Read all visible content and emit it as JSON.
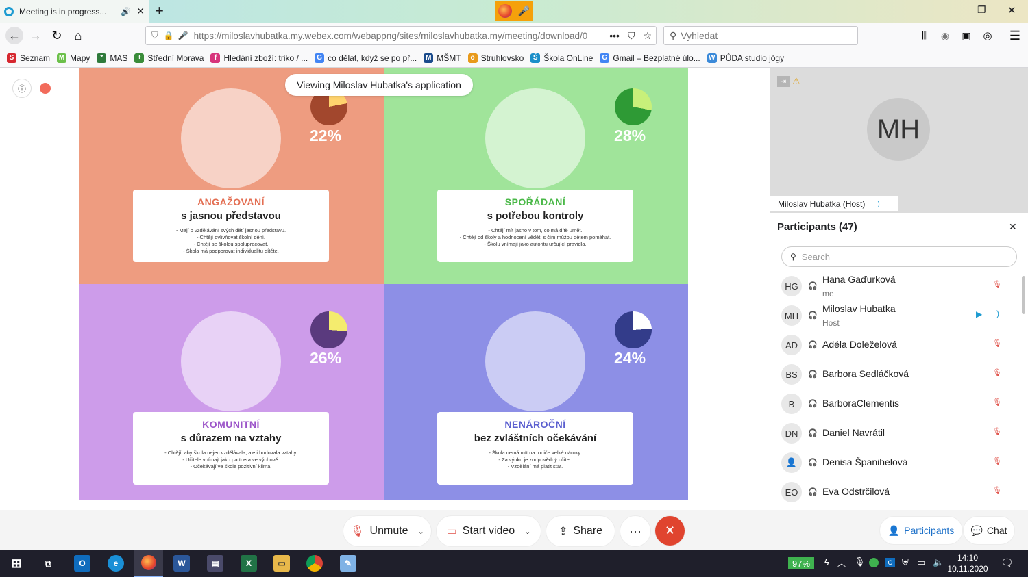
{
  "browser": {
    "tab_title": "Meeting is in progress...",
    "new_tab": "+",
    "url": "https://miloslavhubatka.my.webex.com/webappng/sites/miloslavhubatka.my/meeting/download/0",
    "url_more": "•••",
    "search_placeholder": "Vyhledat",
    "bookmarks": [
      {
        "label": "Seznam",
        "color": "#d6272f",
        "glyph": "S"
      },
      {
        "label": "Mapy",
        "color": "#6cc04a",
        "glyph": "M"
      },
      {
        "label": "MAS",
        "color": "#2f7a3b",
        "glyph": "*"
      },
      {
        "label": "Střední Morava",
        "color": "#3a8c3a",
        "glyph": "+"
      },
      {
        "label": "Hledání zboží: triko / ...",
        "color": "#d7357c",
        "glyph": "f"
      },
      {
        "label": "co dělat, když se po př...",
        "color": "#4285f4",
        "glyph": "G"
      },
      {
        "label": "MŠMT",
        "color": "#1a4b8c",
        "glyph": "M"
      },
      {
        "label": "Struhlovsko",
        "color": "#e89a1c",
        "glyph": "o"
      },
      {
        "label": "Škola OnLine",
        "color": "#1b8fc9",
        "glyph": "Š"
      },
      {
        "label": "Gmail – Bezplatné úlo...",
        "color": "#4285f4",
        "glyph": "G"
      },
      {
        "label": "PŮDA studio jógy",
        "color": "#3b8ad9",
        "glyph": "W"
      }
    ]
  },
  "banner": "Viewing Miloslav Hubatka's application",
  "quadrants": [
    {
      "title": "ANGAŽOVANÍ",
      "subtitle": "s jasnou představou",
      "percent": "22%",
      "share": 22,
      "lines": [
        "- Mají o vzdělávání svých dětí jasnou představu.",
        "- Chtějí ovlivňovat školní dění.",
        "- Chtějí se školou spolupracovat.",
        "- Škola má podporovat individualitu dítěte."
      ],
      "bg": "#ee9c80",
      "title_color": "#e36e52",
      "pie_bg": "#a2472d",
      "pie_fg": "#ffd36e"
    },
    {
      "title": "SPOŘÁDANÍ",
      "subtitle": "s potřebou kontroly",
      "percent": "28%",
      "share": 28,
      "lines": [
        "- Chtějí mít jasno v tom, co má dítě umět.",
        "- Chtějí od školy a hodnocení vědět, s čím můžou dětem pomáhat.",
        "- Školu vnímají jako autoritu určující pravidla."
      ],
      "bg": "#a0e49a",
      "title_color": "#49b847",
      "pie_bg": "#2e9a35",
      "pie_fg": "#c8f07a"
    },
    {
      "title": "KOMUNITNÍ",
      "subtitle": "s důrazem na vztahy",
      "percent": "26%",
      "share": 26,
      "lines": [
        "- Chtějí, aby škola nejen vzdělávala, ale i budovala vztahy.",
        "- Učitele vnímají jako partnera ve výchově.",
        "- Očekávají ve škole pozitivní klima."
      ],
      "bg": "#cd9cea",
      "title_color": "#9c55c9",
      "pie_bg": "#5a3a7e",
      "pie_fg": "#f4ec6e"
    },
    {
      "title": "NENÁROČNÍ",
      "subtitle": "bez zvláštních očekávání",
      "percent": "24%",
      "share": 24,
      "lines": [
        "- Škola nemá mít na rodiče velké nároky.",
        "- Za výuku je zodpovědný učitel.",
        "- Vzdělání má platit stát."
      ],
      "bg": "#8d8fe6",
      "title_color": "#5b5fcf",
      "pie_bg": "#333c8a",
      "pie_fg": "#ffffff"
    }
  ],
  "video": {
    "initials": "MH",
    "name": "Miloslav Hubatka (Host)"
  },
  "participants": {
    "title": "Participants (47)",
    "search_placeholder": "Search",
    "list": [
      {
        "initials": "HG",
        "name": "Hana Gaďurková",
        "sub": "me",
        "muted": true
      },
      {
        "initials": "MH",
        "name": "Miloslav Hubatka",
        "sub": "Host",
        "muted": false
      },
      {
        "initials": "AD",
        "name": "Adéla Doleželová",
        "sub": "",
        "muted": true
      },
      {
        "initials": "BS",
        "name": "Barbora Sedláčková",
        "sub": "",
        "muted": true
      },
      {
        "initials": "B",
        "name": "BarboraClementis",
        "sub": "",
        "muted": true
      },
      {
        "initials": "DN",
        "name": "Daniel Navrátil",
        "sub": "",
        "muted": true
      },
      {
        "initials": "",
        "name": "Denisa Španihelová",
        "sub": "",
        "muted": true
      },
      {
        "initials": "EO",
        "name": "Eva Odstrčilová",
        "sub": "",
        "muted": true
      }
    ]
  },
  "controls": {
    "unmute": "Unmute",
    "start_video": "Start video",
    "share": "Share",
    "more": "···",
    "end": "✕",
    "participants": "Participants",
    "chat": "Chat"
  },
  "taskbar": {
    "battery": "97%",
    "time": "14:10",
    "date": "10.11.2020"
  }
}
